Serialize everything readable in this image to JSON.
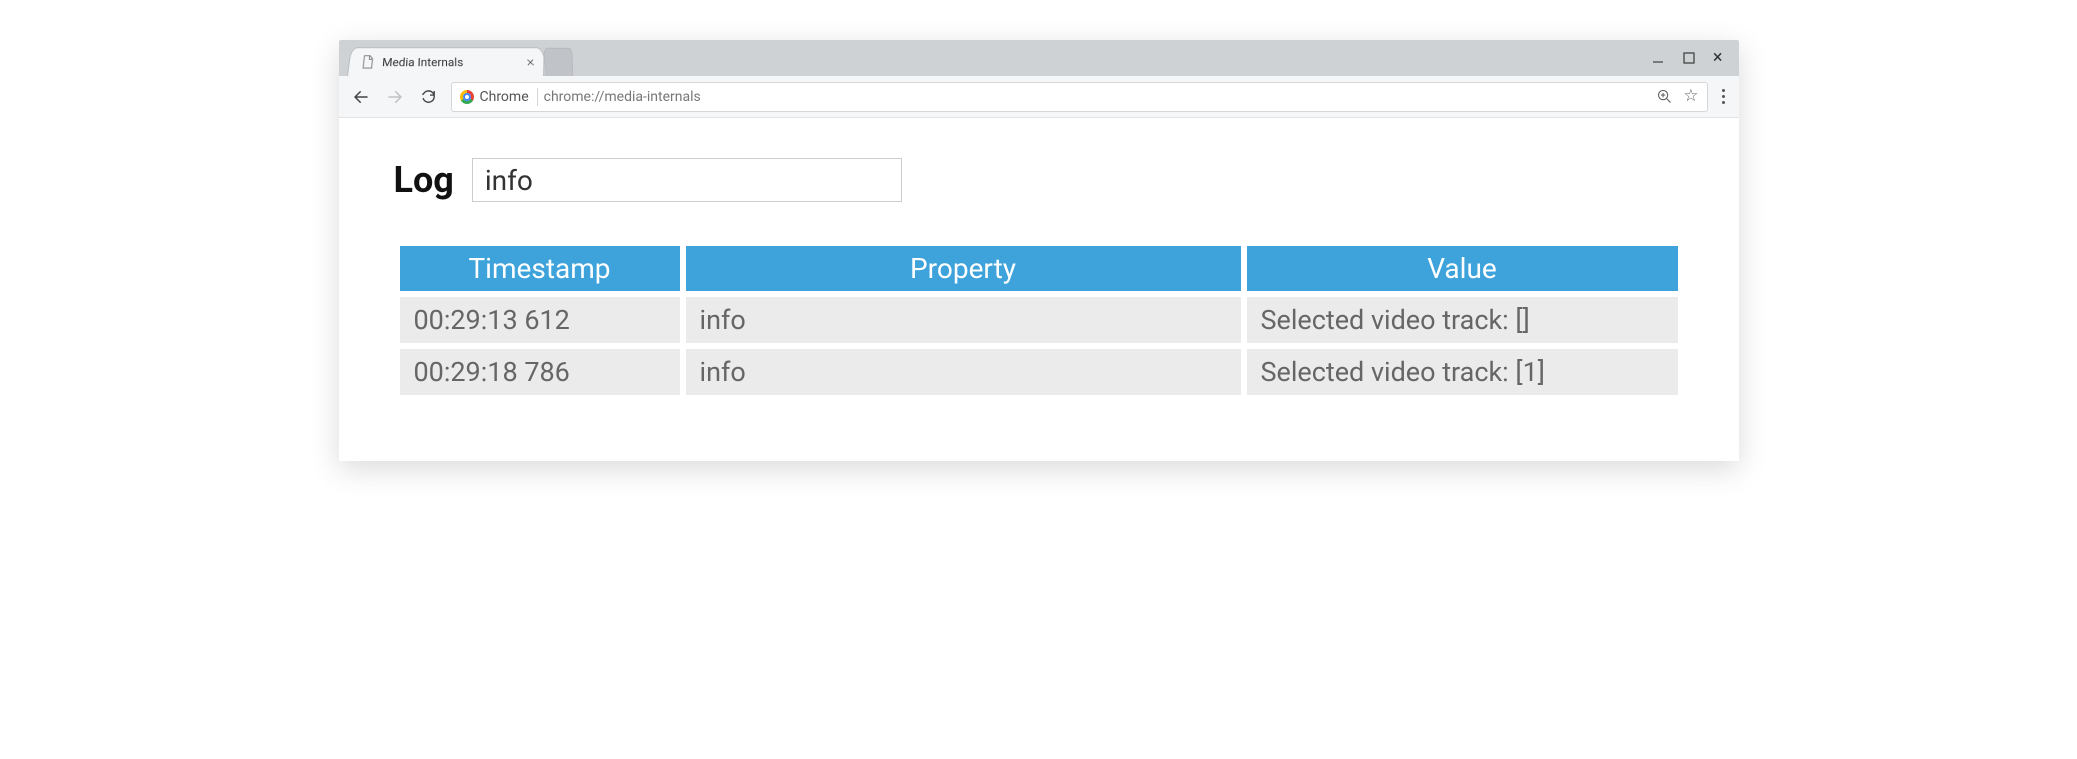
{
  "browser": {
    "tab_title": "Media Internals",
    "origin_label": "Chrome",
    "url": "chrome://media-internals"
  },
  "colors": {
    "table_header_bg": "#3ea3db"
  },
  "page": {
    "heading": "Log",
    "filter_value": "info",
    "columns": [
      "Timestamp",
      "Property",
      "Value"
    ],
    "rows": [
      {
        "timestamp": "00:29:13 612",
        "property": "info",
        "value": "Selected video track: []"
      },
      {
        "timestamp": "00:29:18 786",
        "property": "info",
        "value": "Selected video track: [1]"
      }
    ]
  }
}
